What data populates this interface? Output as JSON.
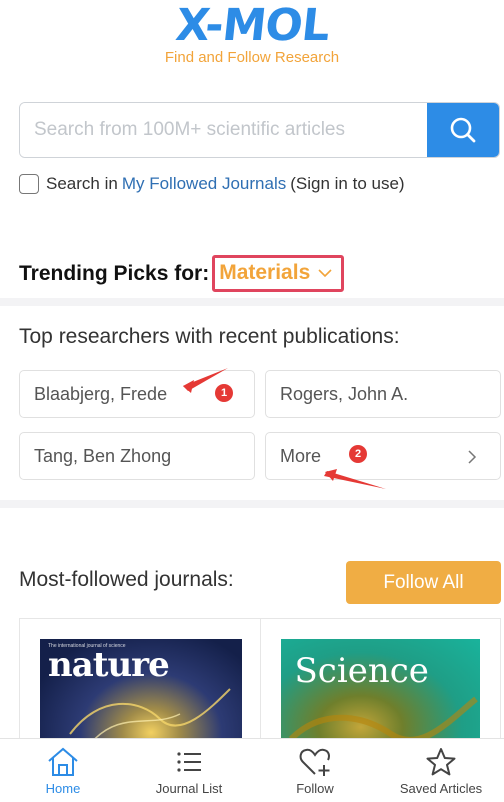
{
  "brand": {
    "logo_text": "X-MOL",
    "tagline": "Find and Follow Research"
  },
  "search": {
    "placeholder": "Search from 100M+ scientific articles",
    "value": ""
  },
  "filter": {
    "prefix": "Search in",
    "link": "My Followed Journals",
    "suffix": "(Sign in to use)",
    "checked": false
  },
  "trending": {
    "label": "Trending Picks for:",
    "selected": "Materials"
  },
  "researchers": {
    "title": "Top researchers with recent publications:",
    "items": [
      "Blaabjerg, Frede",
      "Rogers, John A.",
      "Tang, Ben Zhong"
    ],
    "more_label": "More"
  },
  "annotations": [
    "1",
    "2"
  ],
  "journals": {
    "title": "Most-followed journals:",
    "follow_all_label": "Follow All",
    "items": [
      {
        "cover_title": "nature",
        "cover_subtitle": "The international journal of science"
      },
      {
        "cover_title": "Science",
        "cover_subtitle": ""
      }
    ]
  },
  "tabbar": {
    "items": [
      {
        "label": "Home",
        "icon": "home-icon",
        "active": true
      },
      {
        "label": "Journal List",
        "icon": "list-icon",
        "active": false
      },
      {
        "label": "Follow",
        "icon": "heart-plus-icon",
        "active": false
      },
      {
        "label": "Saved Articles",
        "icon": "star-icon",
        "active": false
      }
    ]
  },
  "colors": {
    "brand_blue": "#2d8ce6",
    "accent_orange": "#f2a43a",
    "annotation_red": "#e0455e"
  }
}
